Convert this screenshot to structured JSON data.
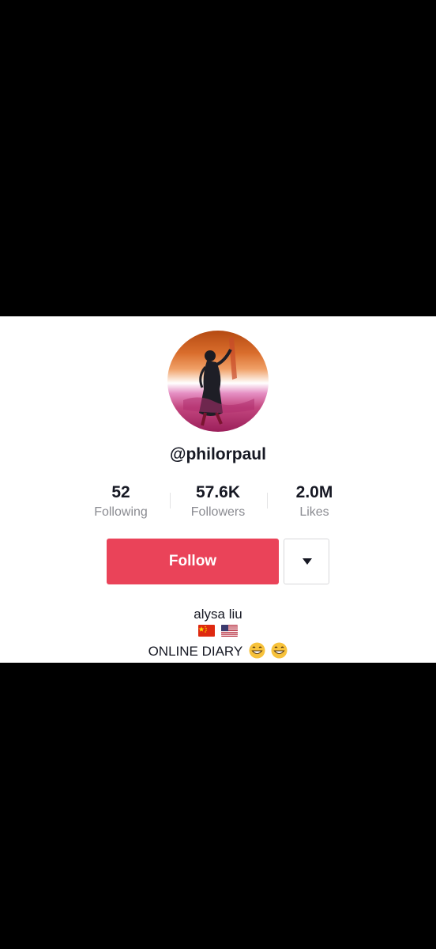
{
  "profile": {
    "username": "@philorpaul",
    "avatar_icon": "profile-photo",
    "stats": [
      {
        "value": "52",
        "label": "Following"
      },
      {
        "value": "57.6K",
        "label": "Followers"
      },
      {
        "value": "2.0M",
        "label": "Likes"
      }
    ],
    "follow_label": "Follow",
    "dropdown_icon": "caret-down-icon",
    "bio": {
      "name": "alysa liu",
      "flags": [
        "china-flag-icon",
        "usa-flag-icon"
      ],
      "text": "ONLINE DIARY",
      "emojis": [
        "grinning-face-icon",
        "grinning-face-icon"
      ]
    }
  },
  "colors": {
    "follow_button": "#ea4359",
    "text_primary": "#161823",
    "text_secondary": "#8a8b91"
  }
}
